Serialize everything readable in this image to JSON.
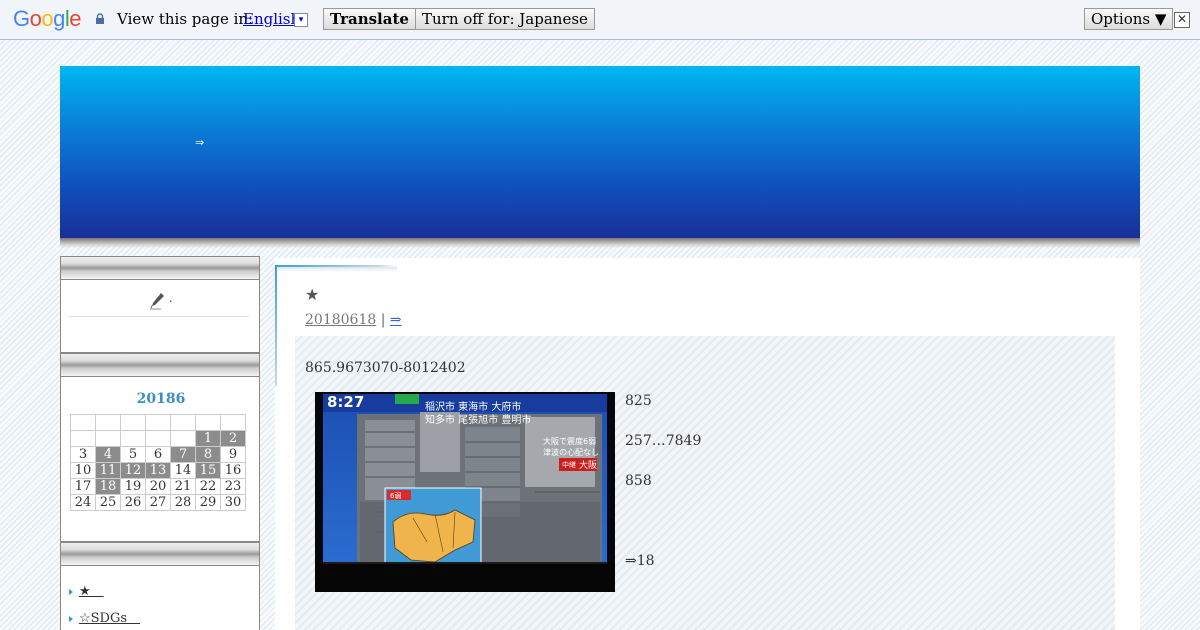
{
  "translate_bar": {
    "logo": [
      "G",
      "o",
      "o",
      "g",
      "l",
      "e"
    ],
    "logo_colors": [
      "#4285f4",
      "#ea4335",
      "#fbbc05",
      "#4285f4",
      "#34a853",
      "#ea4335"
    ],
    "view_text": "View this page in:",
    "language": "English",
    "caret": "▾",
    "translate_label": "Translate",
    "turnoff_label": "Turn off for: Japanese",
    "options_label": "Options ▼",
    "close_label": "✕"
  },
  "header": {
    "link": "⇒",
    "gradient_colors": [
      "#00b7f0",
      "#1a2f98"
    ]
  },
  "sidebar": {
    "profile_text": ".",
    "calendar": {
      "title": "20186",
      "weeks": [
        [
          "",
          "",
          "",
          "",
          "",
          "",
          ""
        ],
        [
          "",
          "",
          "",
          "",
          "",
          "1",
          "2"
        ],
        [
          "3",
          "4",
          "5",
          "6",
          "7",
          "8",
          "9"
        ],
        [
          "10",
          "11",
          "12",
          "13",
          "14",
          "15",
          "16"
        ],
        [
          "17",
          "18",
          "19",
          "20",
          "21",
          "22",
          "23"
        ],
        [
          "24",
          "25",
          "26",
          "27",
          "28",
          "29",
          "30"
        ]
      ],
      "highlighted": [
        "1",
        "2",
        "4",
        "7",
        "8",
        "11",
        "12",
        "13",
        "15",
        "18"
      ]
    },
    "categories": [
      {
        "label": "★　"
      },
      {
        "label": "☆SDGs　"
      }
    ]
  },
  "post": {
    "star": "★",
    "date": "20180618",
    "separator": "|",
    "meta_link": "⇒",
    "lead": "865.9673070-8012402",
    "lines": [
      "825",
      "257…7849",
      "858",
      "⇒18"
    ],
    "photo": {
      "time_text": "8:27",
      "city_rows": [
        "稲沢市  東海市  大府市",
        "知多市  尾張旭市  豊明市"
      ],
      "caption_lines": [
        "大阪で震度6弱",
        "津波の心配なし"
      ],
      "tag": "中継",
      "place": "大阪",
      "map_label": "6弱"
    }
  }
}
